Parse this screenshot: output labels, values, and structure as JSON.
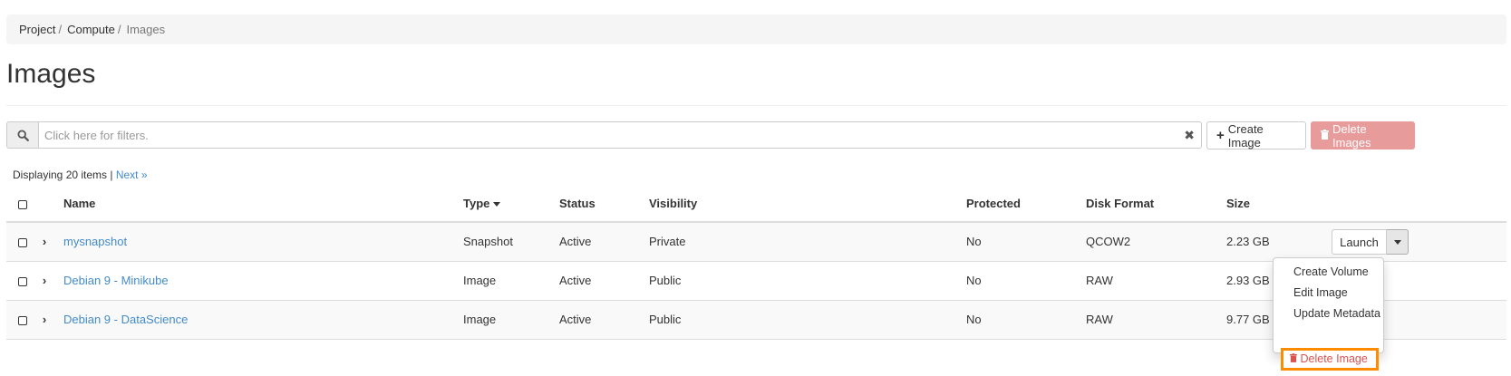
{
  "breadcrumb": [
    "Project",
    "Compute",
    "Images"
  ],
  "page": {
    "title": "Images"
  },
  "filter": {
    "placeholder": "Click here for filters."
  },
  "buttons": {
    "create": "Create Image",
    "delete_all": "Delete Images"
  },
  "pagination": {
    "displaying": "Displaying 20 items |",
    "next": "Next »"
  },
  "table": {
    "columns": {
      "name": "Name",
      "type": "Type",
      "status": "Status",
      "visibility": "Visibility",
      "protected": "Protected",
      "disk_format": "Disk Format",
      "size": "Size"
    },
    "rows": [
      {
        "name": "mysnapshot",
        "type": "Snapshot",
        "status": "Active",
        "visibility": "Private",
        "protected": "No",
        "disk_format": "QCOW2",
        "size": "2.23 GB"
      },
      {
        "name": "Debian 9 - Minikube",
        "type": "Image",
        "status": "Active",
        "visibility": "Public",
        "protected": "No",
        "disk_format": "RAW",
        "size": "2.93 GB"
      },
      {
        "name": "Debian 9 - DataScience",
        "type": "Image",
        "status": "Active",
        "visibility": "Public",
        "protected": "No",
        "disk_format": "RAW",
        "size": "9.77 GB"
      }
    ]
  },
  "row_actions": {
    "launch": "Launch",
    "menu": [
      "Create Volume",
      "Edit Image",
      "Update Metadata",
      "Delete Image"
    ]
  },
  "colors": {
    "link": "#428bca",
    "danger": "#d9534f",
    "danger_disabled": "#e89b9b",
    "highlight": "#ff8c00"
  },
  "icons": {
    "search": "search-icon",
    "clear": "clear-icon",
    "plus": "plus-icon",
    "trash": "trash-icon",
    "expand": "chevron-right-icon",
    "sort": "caret-down-icon"
  }
}
